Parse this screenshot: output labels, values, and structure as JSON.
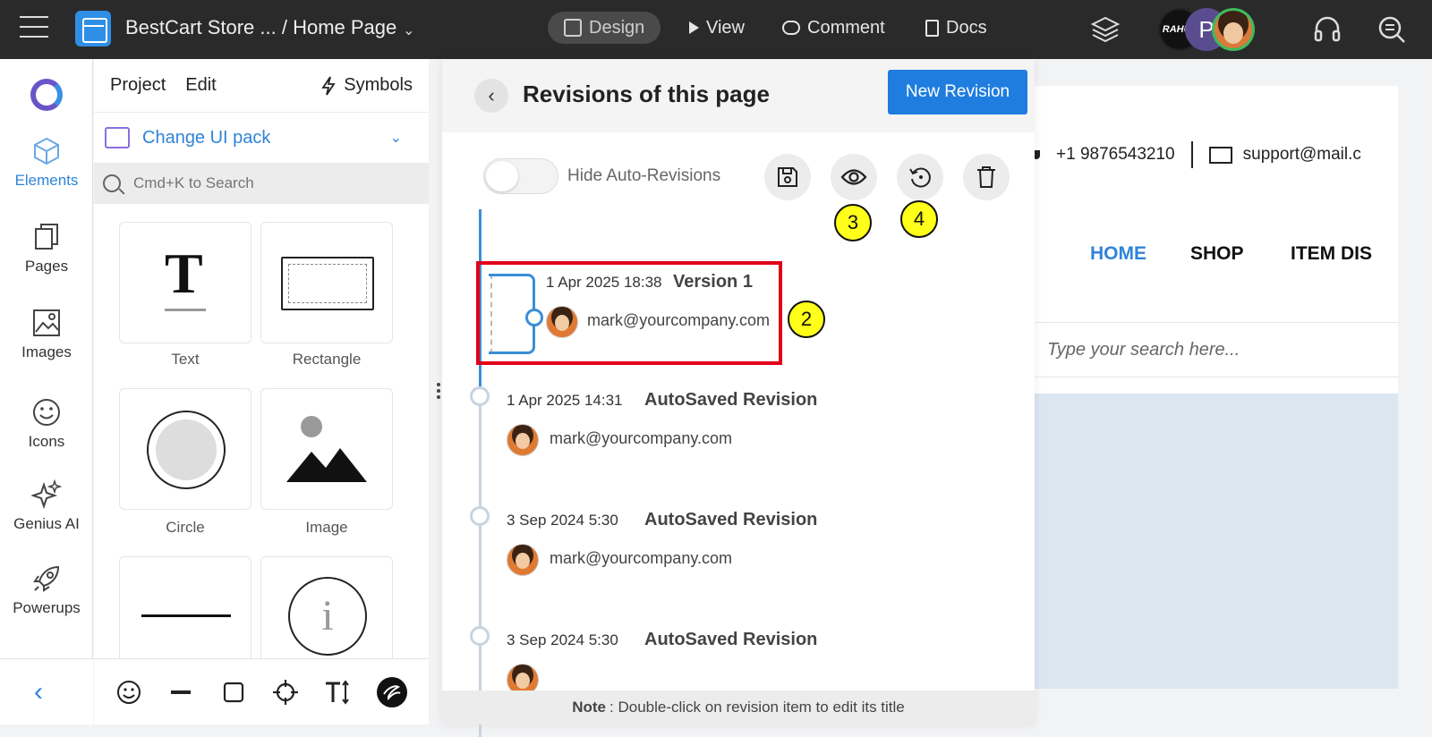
{
  "topbar": {
    "project_title": "BestCart Store ... / Home Page",
    "tabs": [
      {
        "label": "Design"
      },
      {
        "label": "View"
      },
      {
        "label": "Comment"
      },
      {
        "label": "Docs"
      }
    ],
    "avatar1_text": "RAHUL",
    "avatar2_text": "P"
  },
  "rail": {
    "items": [
      {
        "label": "Elements",
        "icon": "cube-icon"
      },
      {
        "label": "Pages",
        "icon": "pages-icon"
      },
      {
        "label": "Images",
        "icon": "image-icon"
      },
      {
        "label": "Icons",
        "icon": "smiley-icon"
      },
      {
        "label": "Genius AI",
        "icon": "sparkle-icon"
      },
      {
        "label": "Powerups",
        "icon": "rocket-icon"
      }
    ]
  },
  "panel": {
    "menu_project": "Project",
    "menu_edit": "Edit",
    "symbols": "Symbols",
    "ui_pack": "Change UI pack",
    "search_placeholder": "Cmd+K to Search",
    "tiles": [
      {
        "label": "Text"
      },
      {
        "label": "Rectangle"
      },
      {
        "label": "Circle"
      },
      {
        "label": "Image"
      },
      {
        "label": ""
      },
      {
        "label": ""
      }
    ],
    "text_tile_glyph": "T",
    "info_glyph": "i"
  },
  "canvas": {
    "phone": "+1 9876543210",
    "email": "support@mail.c",
    "nav": [
      "HOME",
      "SHOP",
      "ITEM DIS"
    ],
    "search_placeholder": "Type your search here..."
  },
  "revisions": {
    "title": "Revisions of this page",
    "new_button": "New Revision",
    "hide_auto": "Hide Auto-Revisions",
    "badges": [
      "2",
      "3",
      "4"
    ],
    "items": [
      {
        "date": "1 Apr 2025 18:38",
        "name": "Version 1",
        "user": "mark@yourcompany.com"
      },
      {
        "date": "1 Apr 2025 14:31",
        "name": "AutoSaved Revision",
        "user": "mark@yourcompany.com"
      },
      {
        "date": "3 Sep 2024 5:30",
        "name": "AutoSaved Revision",
        "user": "mark@yourcompany.com"
      },
      {
        "date": "3 Sep 2024 5:30",
        "name": "AutoSaved Revision",
        "user": ""
      }
    ],
    "note_label": "Note",
    "note_text": ": Double-click on revision item to edit its title"
  },
  "colors": {
    "accent": "#1f7de0",
    "highlight": "#e0001a",
    "badge": "#ffff1a"
  }
}
